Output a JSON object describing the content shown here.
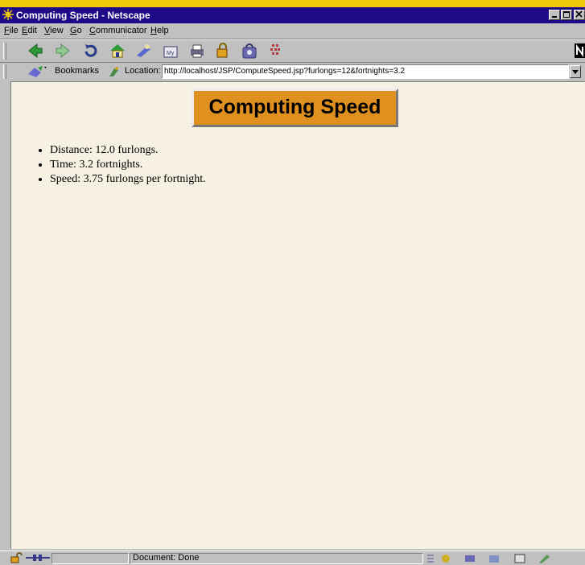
{
  "window": {
    "title": "Computing Speed - Netscape",
    "accent_color": "#1e0a86",
    "controls": [
      "minimize-icon",
      "maximize-icon",
      "close-icon"
    ]
  },
  "menubar": {
    "items": [
      {
        "key": "F",
        "rest": "ile"
      },
      {
        "key": "E",
        "rest": "dit"
      },
      {
        "key": "V",
        "rest": "iew"
      },
      {
        "key": "G",
        "rest": "o"
      },
      {
        "key": "C",
        "rest": "ommunicator"
      },
      {
        "key": "H",
        "rest": "elp"
      }
    ]
  },
  "toolbar": {
    "buttons": [
      "back-icon",
      "forward-icon",
      "reload-icon",
      "home-icon",
      "search-icon",
      "my-netscape-icon",
      "print-icon",
      "security-icon",
      "shop-icon",
      "stop-icon"
    ]
  },
  "location_bar": {
    "bookmarks_label": "Bookmarks",
    "location_label": "Location:",
    "url": "http://localhost/JSP/ComputeSpeed.jsp?furlongs=12&fortnights=3.2"
  },
  "page": {
    "heading": "Computing Speed",
    "heading_color": "#e0901e",
    "background_color": "#f6f1e2",
    "items": [
      "Distance: 12.0 furlongs.",
      "Time: 3.2 fortnights.",
      "Speed: 3.75 furlongs per fortnight."
    ]
  },
  "status_bar": {
    "text": "Document: Done"
  }
}
